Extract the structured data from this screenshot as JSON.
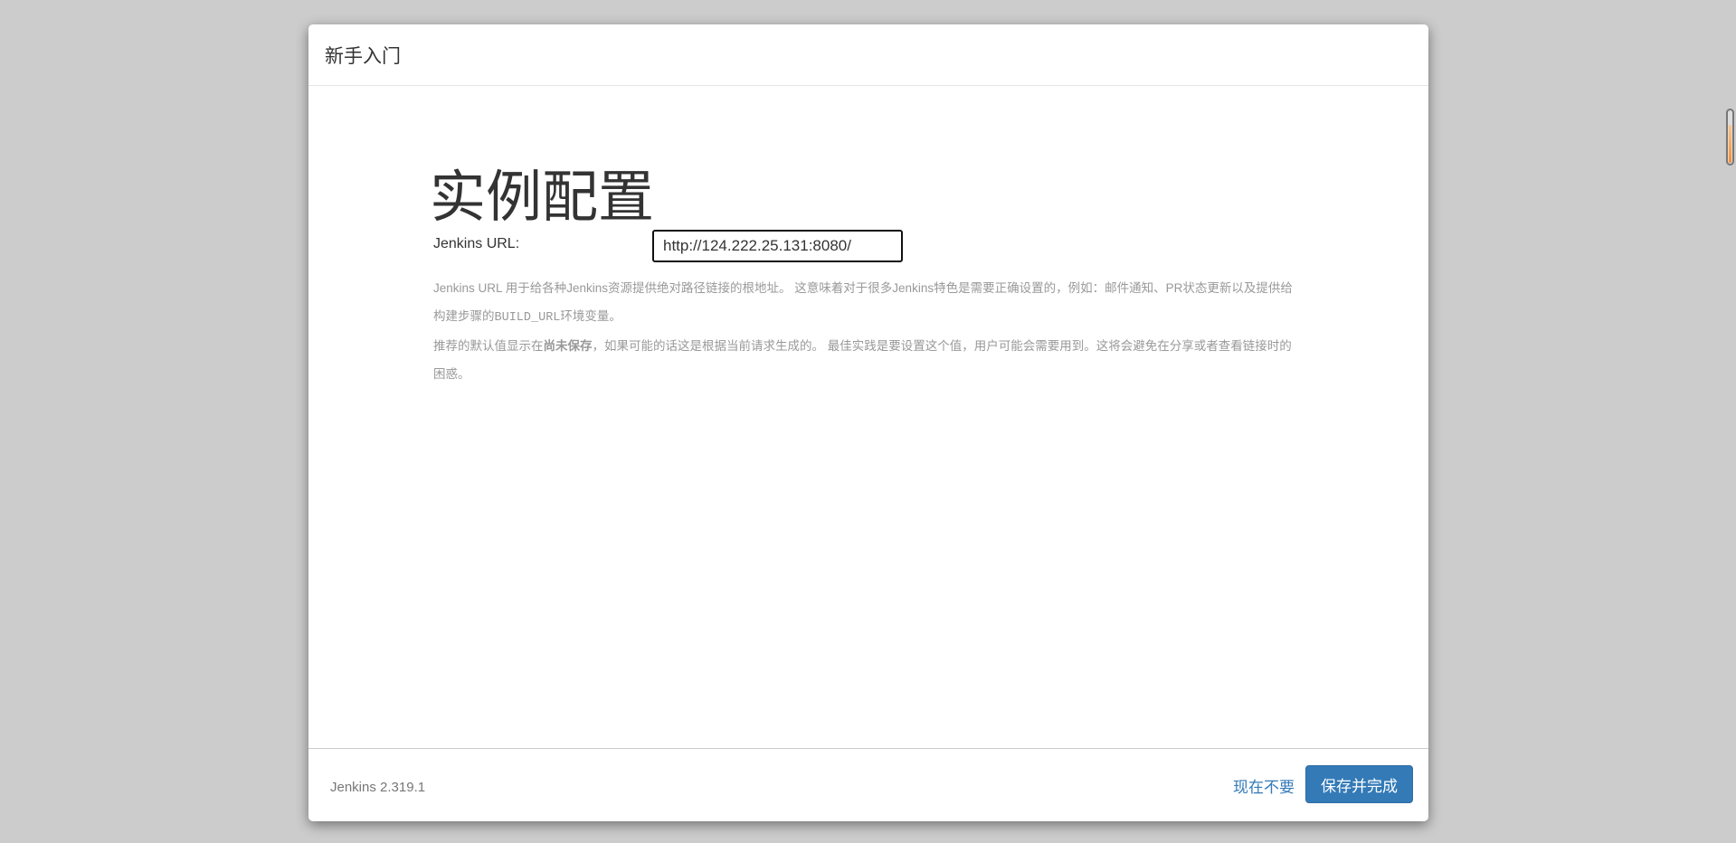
{
  "header": {
    "title": "新手入门"
  },
  "main": {
    "heading": "实例配置",
    "url_label": "Jenkins URL:",
    "url_value": "http://124.222.25.131:8080/",
    "desc1": "Jenkins URL 用于给各种Jenkins资源提供绝对路径链接的根地址。 这意味着对于很多Jenkins特色是需要正确设置的，例如：邮件通知、PR状态更新以及提供给构建步骤的",
    "desc1_code": "BUILD_URL",
    "desc1_end": "环境变量。",
    "desc2_start": "推荐的默认值显示在",
    "desc2_bold": "尚未保存",
    "desc2_end": "，如果可能的话这是根据当前请求生成的。 最佳实践是要设置这个值，用户可能会需要用到。这将会避免在分享或者查看链接时的困惑。"
  },
  "footer": {
    "version": "Jenkins 2.319.1",
    "skip_label": "现在不要",
    "save_label": "保存并完成"
  },
  "colors": {
    "accent": "#337ab7"
  }
}
